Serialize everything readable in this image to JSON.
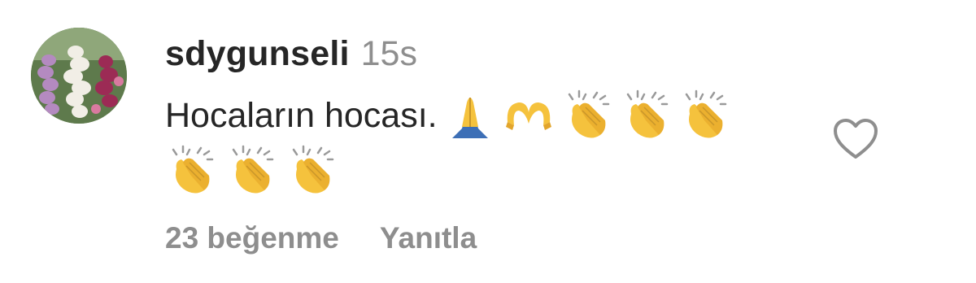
{
  "comment": {
    "username": "sdygunseli",
    "time": "15s",
    "text": "Hocaların hocası.",
    "emojis_line1": [
      "folded-hands",
      "heart-hands",
      "clapping-hands",
      "clapping-hands",
      "clapping-hands"
    ],
    "emojis_line2": [
      "clapping-hands",
      "clapping-hands",
      "clapping-hands"
    ]
  },
  "actions": {
    "likes_label": "23 beğenme",
    "reply_label": "Yanıtla"
  },
  "icons": {
    "avatar": "avatar-foxglove-photo",
    "like": "heart-outline-icon"
  },
  "colors": {
    "text_primary": "#262626",
    "text_secondary": "#8e8e8e",
    "emoji_yellow": "#f5c23d",
    "emoji_blue": "#3d6fb6"
  }
}
